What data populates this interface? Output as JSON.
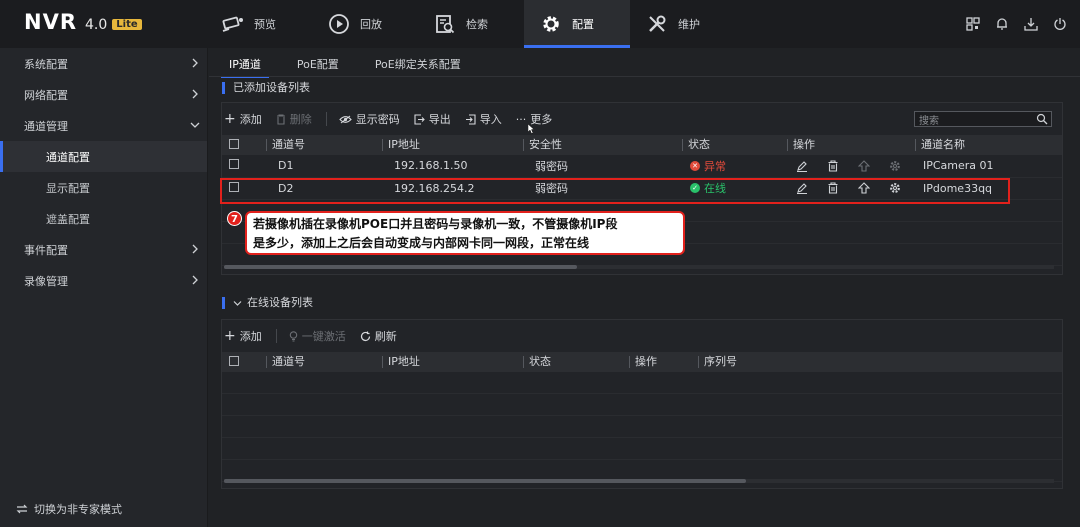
{
  "brand": {
    "name": "NVR",
    "version": "4.0",
    "edition": "Lite"
  },
  "nav": [
    {
      "label": "预览",
      "icon": "camera-icon"
    },
    {
      "label": "回放",
      "icon": "playback-icon"
    },
    {
      "label": "检索",
      "icon": "search-doc-icon"
    },
    {
      "label": "配置",
      "icon": "gear-icon",
      "active": true
    },
    {
      "label": "维护",
      "icon": "tools-icon"
    }
  ],
  "sidebar": {
    "items": [
      {
        "label": "系统配置"
      },
      {
        "label": "网络配置"
      },
      {
        "label": "通道管理"
      },
      {
        "label": "事件配置"
      },
      {
        "label": "录像管理"
      }
    ],
    "sub_items": [
      {
        "label": "通道配置",
        "active": true
      },
      {
        "label": "显示配置"
      },
      {
        "label": "遮盖配置"
      }
    ],
    "bottom_label": "切换为非专家模式"
  },
  "tabs": [
    {
      "label": "IP通道",
      "active": true
    },
    {
      "label": "PoE配置"
    },
    {
      "label": "PoE绑定关系配置"
    }
  ],
  "added": {
    "title": "已添加设备列表",
    "toolbar": {
      "add": "添加",
      "delete": "删除",
      "show_password": "显示密码",
      "export": "导出",
      "import": "导入",
      "more": "更多"
    },
    "search_placeholder": "搜索",
    "columns": [
      "通道号",
      "IP地址",
      "安全性",
      "状态",
      "操作",
      "通道名称"
    ],
    "rows": [
      {
        "channel": "D1",
        "ip": "192.168.1.50",
        "security": "弱密码",
        "status": "异常",
        "status_type": "error",
        "name": "IPCamera 01"
      },
      {
        "channel": "D2",
        "ip": "192.168.254.2",
        "security": "弱密码",
        "status": "在线",
        "status_type": "ok",
        "name": "IPdome33qq"
      }
    ]
  },
  "callout": {
    "number": "7",
    "line1": "若摄像机插在录像机POE口并且密码与录像机一致，不管摄像机IP段",
    "line2": "是多少，添加上之后会自动变成与内部网卡同一网段，正常在线"
  },
  "online": {
    "title": "在线设备列表",
    "toolbar": {
      "add": "添加",
      "activate": "一键激活",
      "refresh": "刷新"
    },
    "columns": [
      "通道号",
      "IP地址",
      "状态",
      "操作",
      "序列号"
    ]
  },
  "colors": {
    "accent": "#3a6ff0",
    "error": "#e24b3b",
    "ok": "#29c16a",
    "highlight": "#e2211c"
  }
}
